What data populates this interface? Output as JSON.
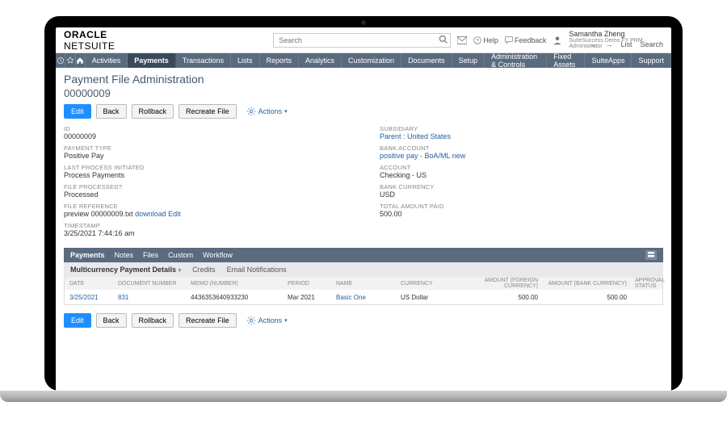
{
  "brand": {
    "p1": "ORACLE",
    "p2": "NETSUITE"
  },
  "search": {
    "placeholder": "Search"
  },
  "header": {
    "help": "Help",
    "feedback": "Feedback",
    "user_name": "Samantha Zheng",
    "user_role": "SuiteSuccess Demo FY PRM · Administrator"
  },
  "nav": {
    "items": [
      "Activities",
      "Payments",
      "Transactions",
      "Lists",
      "Reports",
      "Analytics",
      "Customization",
      "Documents",
      "Setup",
      "Administration & Controls",
      "Fixed Assets",
      "SuiteApps",
      "Support"
    ],
    "active": "Payments"
  },
  "page": {
    "title": "Payment File Administration",
    "record": "00000009",
    "btn_edit": "Edit",
    "btn_back": "Back",
    "btn_rollback": "Rollback",
    "btn_recreate": "Recreate File",
    "actions": "Actions",
    "tool_list": "List",
    "tool_search": "Search"
  },
  "fields_left": [
    {
      "lbl": "ID",
      "val": "00000009"
    },
    {
      "lbl": "PAYMENT TYPE",
      "val": "Positive Pay"
    },
    {
      "lbl": "LAST PROCESS INITIATED",
      "val": "Process Payments"
    },
    {
      "lbl": "FILE PROCESSED?",
      "val": "Processed"
    },
    {
      "lbl": "FILE REFERENCE",
      "val_html": "preview 00000009.txt",
      "extra1": "download",
      "extra2": "Edit"
    },
    {
      "lbl": "TIMESTAMP",
      "val": "3/25/2021 7:44:16 am"
    }
  ],
  "fields_right": [
    {
      "lbl": "SUBSIDIARY",
      "link": "Parent : United States"
    },
    {
      "lbl": "BANK ACCOUNT",
      "link": "positive pay - BoA/ML new"
    },
    {
      "lbl": "ACCOUNT",
      "val": "Checking - US"
    },
    {
      "lbl": "BANK CURRENCY",
      "val": "USD"
    },
    {
      "lbl": "TOTAL AMOUNT PAID",
      "val": "500.00"
    }
  ],
  "subtabs": [
    "Payments",
    "Notes",
    "Files",
    "Custom",
    "Workflow"
  ],
  "subtab_active": "Payments",
  "sublist": {
    "active": "Multicurrency Payment Details",
    "credits": "Credits",
    "email": "Email Notifications"
  },
  "table": {
    "cols": [
      "DATE",
      "DOCUMENT NUMBER",
      "MEMO (NUMBER)",
      "PERIOD",
      "NAME",
      "CURRENCY",
      "AMOUNT (FOREIGN CURRENCY)",
      "AMOUNT (BANK CURRENCY)",
      "APPROVAL STATUS"
    ],
    "rows": [
      {
        "date": "3/25/2021",
        "doc": "831",
        "memo": "4436353640933230",
        "period": "Mar 2021",
        "name": "Basic One",
        "currency": "US Dollar",
        "amt_foreign": "500.00",
        "amt_bank": "500.00",
        "approval": ""
      }
    ]
  }
}
